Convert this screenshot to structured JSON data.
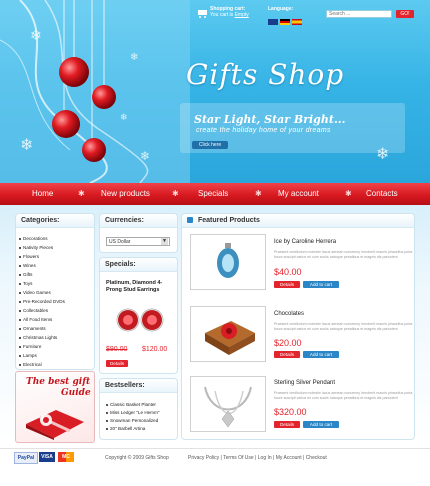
{
  "header": {
    "cart_label": "Shopping cart:",
    "cart_status": "You cart is",
    "cart_link": "Empty",
    "language_label": "Language:",
    "search_placeholder": "Search ...",
    "search_button": "GO!",
    "logo_title": "Gifts Shop",
    "slogan": "Star Light, Star Bright...",
    "subslogan": "create the holiday home of your dreams",
    "cta_button": "Click here"
  },
  "nav": {
    "items": [
      "Home",
      "New products",
      "Specials",
      "My account",
      "Contacts"
    ]
  },
  "categories": {
    "title": "Categories:",
    "items": [
      "Decorations",
      "Nativity Pieces",
      "Flowers",
      "Wines",
      "Gifts",
      "Toys",
      "Video Games",
      "Pre-Recorded DVDs",
      "Collectables",
      "All Food Items",
      "Ornaments",
      "Christmas Lights",
      "Furniture",
      "Lamps",
      "Electrical"
    ]
  },
  "currencies": {
    "title": "Currencies:",
    "selected": "US Dollar"
  },
  "specials": {
    "title": "Specials:",
    "product_name": "Platinum, Diamond 4-Prong Stud Earrings",
    "old_price": "$90.00",
    "new_price": "$120.00",
    "details_button": "Details"
  },
  "bestsellers": {
    "title": "Bestsellers:",
    "items": [
      "Classic Basket Planter",
      "Miss Ledger \"Le Hemm\"",
      "Snowman Personalized",
      "20\" Barbell Artina"
    ]
  },
  "promo": {
    "line1": "The best gift",
    "line2": "Guide"
  },
  "featured": {
    "title": "Featured Products",
    "products": [
      {
        "name": "Ice by Caroline Herrera",
        "desc": "Praesent vestibulum molestie lacus aenean nonummy hendrerit mauris phasellus porta fusce suscipit varius mi cum sociis natoque penatibus et magnis dis parturient",
        "price": "$40.00",
        "details": "Details",
        "add": "Add to cart"
      },
      {
        "name": "Chocolates",
        "desc": "Praesent vestibulum molestie lacus aenean nonummy hendrerit mauris phasellus porta fusce suscipit varius mi cum sociis natoque penatibus et magnis dis parturient",
        "price": "$20.00",
        "details": "Details",
        "add": "Add to cart"
      },
      {
        "name": "Sterling Silver Pendant",
        "desc": "Praesent vestibulum molestie lacus aenean nonummy hendrerit mauris phasellus porta fusce suscipit varius mi cum sociis natoque penatibus et magnis dis parturient",
        "price": "$320.00",
        "details": "Details",
        "add": "Add to cart"
      }
    ]
  },
  "footer": {
    "payments": [
      "PayPal",
      "VISA",
      "MC"
    ],
    "copyright": "Copyright © 2009 Gifts Shop",
    "links": [
      "Privacy Policy",
      "Terms Of Use",
      "Log In",
      "My Account",
      "Checkout"
    ]
  },
  "colors": {
    "header_blue": "#37b4e6",
    "nav_red": "#d81920",
    "price_red": "#e4242d",
    "button_blue": "#2a86c6"
  }
}
